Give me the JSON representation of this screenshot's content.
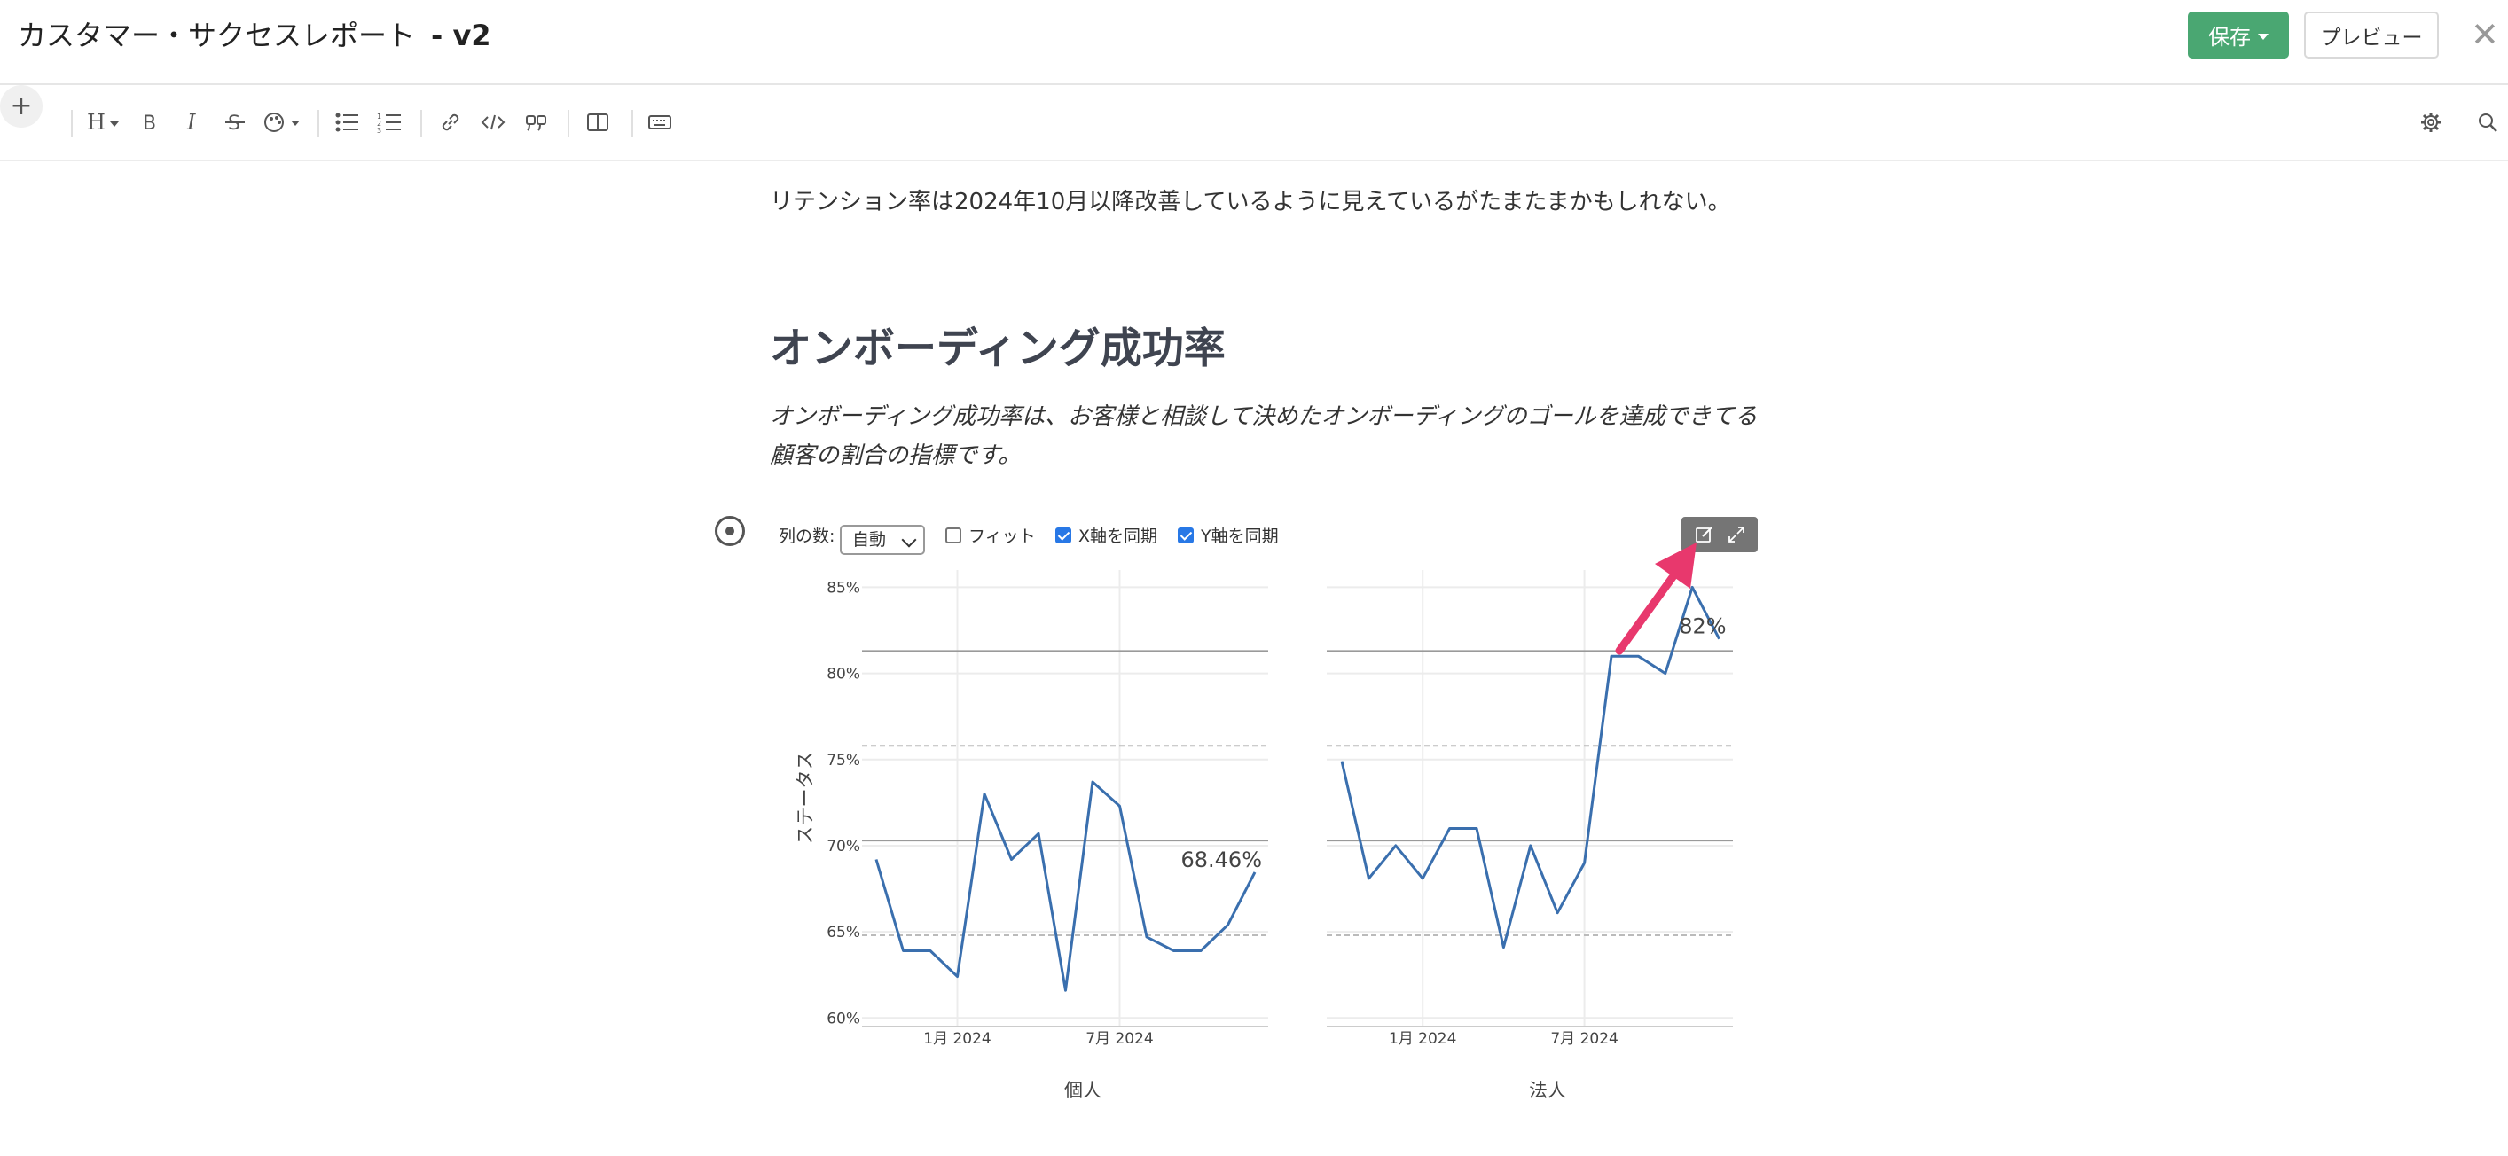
{
  "header": {
    "title": "カスタマー・サクセスレポート",
    "version": "- v2",
    "save_label": "保存",
    "preview_label": "プレビュー",
    "close_label": "✕"
  },
  "toolbar": {
    "items": [
      "plus",
      "heading",
      "bold",
      "italic",
      "strikethrough",
      "color",
      "bullet-list",
      "numbered-list",
      "link",
      "code",
      "quote",
      "columns",
      "keyboard",
      "settings",
      "search"
    ]
  },
  "content": {
    "paragraph": "リテンション率は2024年10月以降改善しているように見えているがたまたまかもしれない。",
    "heading": "オンボーディング成功率",
    "description": "オンボーディング成功率は、お客様と相談して決めたオンボーディングのゴールを達成できてる顧客の割合の指標です。"
  },
  "chart_controls": {
    "columns_label": "列の数:",
    "columns_value": "自動",
    "fit_label": "フィット",
    "fit_checked": false,
    "sync_x_label": "X軸を同期",
    "sync_x_checked": true,
    "sync_y_label": "Y軸を同期",
    "sync_y_checked": true
  },
  "chart_data": {
    "type": "line",
    "ylabel": "ステータス",
    "y_ticks": [
      "60%",
      "65%",
      "70%",
      "75%",
      "80%",
      "85%"
    ],
    "ylim": [
      59.5,
      86
    ],
    "x_ticks": [
      "1月 2024",
      "7月 2024"
    ],
    "line_color": "#3a6fae",
    "reference_lines": {
      "solid": [
        70.3,
        81.3
      ],
      "dashed": [
        64.8,
        75.8
      ]
    },
    "panels": [
      {
        "name": "個人",
        "end_label": "68.46%",
        "x": [
          "2023-10",
          "2023-11",
          "2023-12",
          "2024-01",
          "2024-02",
          "2024-03",
          "2024-04",
          "2024-05",
          "2024-06",
          "2024-07",
          "2024-08",
          "2024-09",
          "2024-10",
          "2024-11",
          "2024-12"
        ],
        "values": [
          69.2,
          63.9,
          63.9,
          62.4,
          73.0,
          69.2,
          70.7,
          61.6,
          73.7,
          72.3,
          64.7,
          63.9,
          63.9,
          65.4,
          68.46
        ]
      },
      {
        "name": "法人",
        "end_label": "82%",
        "x": [
          "2023-10",
          "2023-11",
          "2023-12",
          "2024-01",
          "2024-02",
          "2024-03",
          "2024-04",
          "2024-05",
          "2024-06",
          "2024-07",
          "2024-08",
          "2024-09",
          "2024-10",
          "2024-11",
          "2024-12"
        ],
        "values": [
          74.9,
          68.1,
          70.0,
          68.1,
          71.0,
          71.0,
          64.1,
          70.0,
          66.1,
          69.0,
          81.0,
          81.0,
          80.0,
          85.0,
          82.0
        ]
      }
    ]
  },
  "annotation": {
    "arrow_color": "#e8386d"
  }
}
